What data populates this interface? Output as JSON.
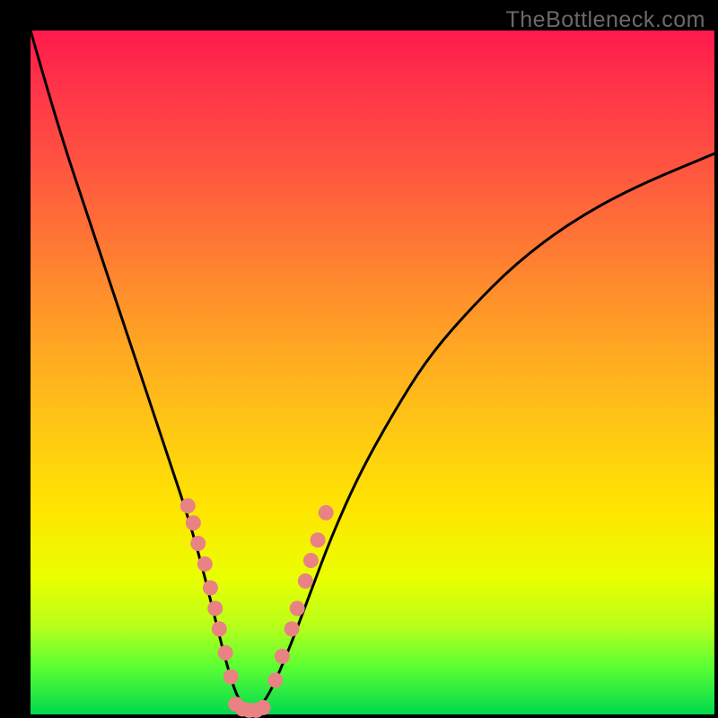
{
  "watermark": "TheBottleneck.com",
  "colors": {
    "curve": "#000000",
    "dot_fill": "#e98282",
    "dot_stroke": "#9c4a4a"
  },
  "chart_data": {
    "type": "line",
    "title": "",
    "xlabel": "",
    "ylabel": "",
    "xlim": [
      0,
      100
    ],
    "ylim": [
      0,
      100
    ],
    "series": [
      {
        "name": "curve",
        "x": [
          0,
          2,
          5,
          8,
          11,
          14,
          17,
          20,
          23,
          25,
          27,
          28.5,
          30,
          31.5,
          33,
          35,
          38,
          41,
          44,
          48,
          53,
          58,
          64,
          71,
          79,
          88,
          100
        ],
        "values": [
          100,
          93,
          83,
          74,
          65,
          56,
          47,
          38,
          29,
          22,
          14,
          8,
          3,
          0.5,
          0.5,
          3,
          10,
          18,
          26,
          35,
          44,
          52,
          59,
          66,
          72,
          77,
          82
        ]
      }
    ],
    "annotations": {
      "dots_left": [
        {
          "x": 23.0,
          "y": 30.5
        },
        {
          "x": 23.8,
          "y": 28.0
        },
        {
          "x": 24.5,
          "y": 25.0
        },
        {
          "x": 25.5,
          "y": 22.0
        },
        {
          "x": 26.3,
          "y": 18.5
        },
        {
          "x": 27.0,
          "y": 15.5
        },
        {
          "x": 27.6,
          "y": 12.5
        },
        {
          "x": 28.5,
          "y": 9.0
        },
        {
          "x": 29.3,
          "y": 5.5
        }
      ],
      "dots_bottom": [
        {
          "x": 30.0,
          "y": 1.5
        },
        {
          "x": 31.0,
          "y": 0.8
        },
        {
          "x": 32.0,
          "y": 0.6
        },
        {
          "x": 33.0,
          "y": 0.6
        },
        {
          "x": 34.0,
          "y": 1.0
        }
      ],
      "dots_right": [
        {
          "x": 35.8,
          "y": 5.0
        },
        {
          "x": 36.8,
          "y": 8.5
        },
        {
          "x": 38.2,
          "y": 12.5
        },
        {
          "x": 39.0,
          "y": 15.5
        },
        {
          "x": 40.2,
          "y": 19.5
        },
        {
          "x": 41.0,
          "y": 22.5
        },
        {
          "x": 42.0,
          "y": 25.5
        },
        {
          "x": 43.2,
          "y": 29.5
        }
      ]
    }
  }
}
